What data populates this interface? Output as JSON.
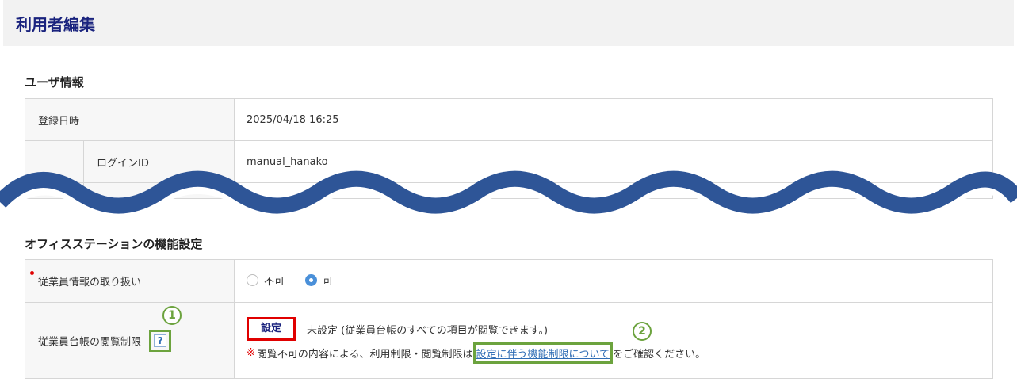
{
  "header": {
    "title": "利用者編集"
  },
  "user_info": {
    "section_title": "ユーザ情報",
    "rows": [
      {
        "label": "登録日時",
        "value": "2025/04/18 16:25"
      },
      {
        "label": "ログインID",
        "value": "manual_hanako"
      }
    ]
  },
  "office_station": {
    "section_title": "オフィスステーションの機能設定",
    "employee_info": {
      "label": "従業員情報の取り扱い",
      "options": [
        {
          "label": "不可",
          "selected": false
        },
        {
          "label": "可",
          "selected": true
        }
      ]
    },
    "ledger_restriction": {
      "label": "従業員台帳の閲覧制限",
      "help_icon": "?",
      "marker1": "1",
      "set_button": "設定",
      "status": "未設定 (従業員台帳のすべての項目が閲覧できます。)",
      "marker2": "2",
      "note_mark": "※",
      "note_prefix": "閲覧不可の内容による、利用制限・閲覧制限は",
      "note_link": "設定に伴う機能制限について",
      "note_suffix": "をご確認ください。"
    }
  },
  "colors": {
    "title": "#1a237e",
    "wave": "#2e5597",
    "highlight_red": "#e00000",
    "highlight_green": "#6ca33e",
    "link": "#2f6db5"
  }
}
